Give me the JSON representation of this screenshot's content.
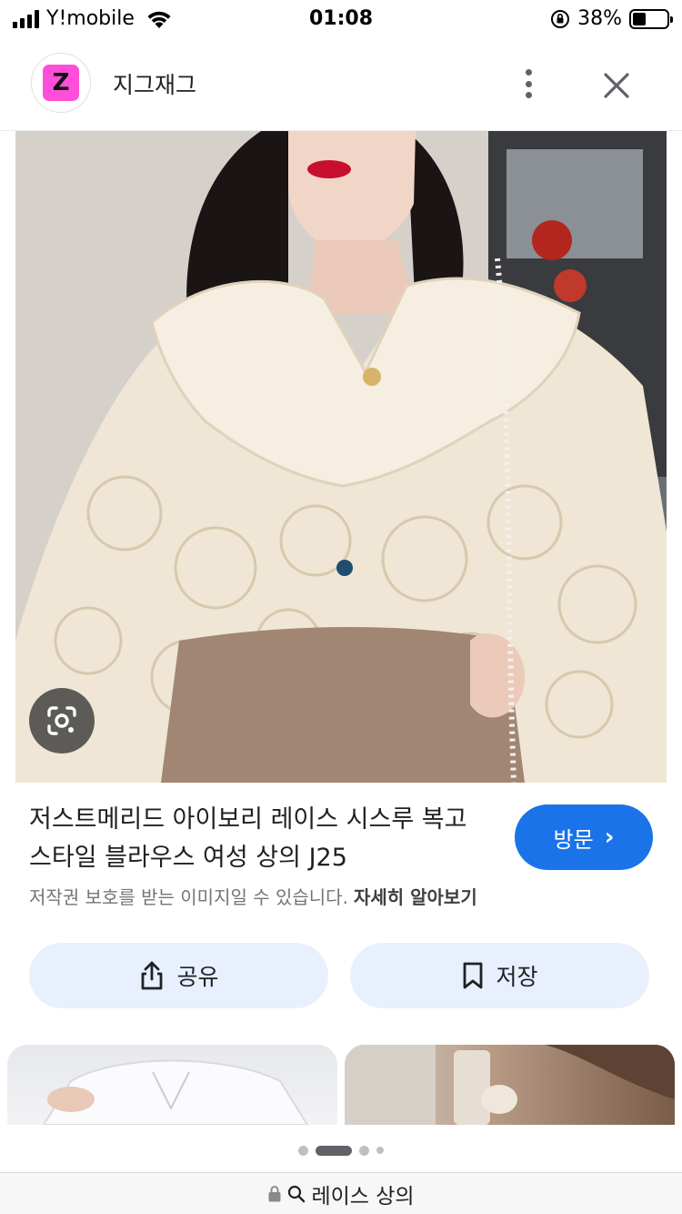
{
  "status_bar": {
    "carrier": "Y!mobile",
    "time": "01:08",
    "battery_percent": "38%",
    "battery_level": 0.38
  },
  "header": {
    "site_logo_letter": "Z",
    "site_name": "지그재그",
    "logo_color": "#ff4fd8"
  },
  "product": {
    "title": "저스트메리드 아이보리 레이스 시스루 복고 스타일 블라우스 여성 상의 J25",
    "visit_label": "방문",
    "copyright_notice": "저작권 보호를 받는 이미지일 수 있습니다.",
    "learn_more": "자세히 알아보기"
  },
  "actions": {
    "share_label": "공유",
    "save_label": "저장"
  },
  "url_bar": {
    "query": "레이스 상의"
  },
  "colors": {
    "accent": "#1a73e8",
    "action_bg": "#e8f0fe"
  },
  "icons": {
    "lens": "google-lens-icon",
    "share": "share-icon",
    "save": "bookmark-icon",
    "more": "more-vert-icon",
    "close": "close-icon",
    "lock": "lock-icon",
    "search": "search-icon"
  }
}
